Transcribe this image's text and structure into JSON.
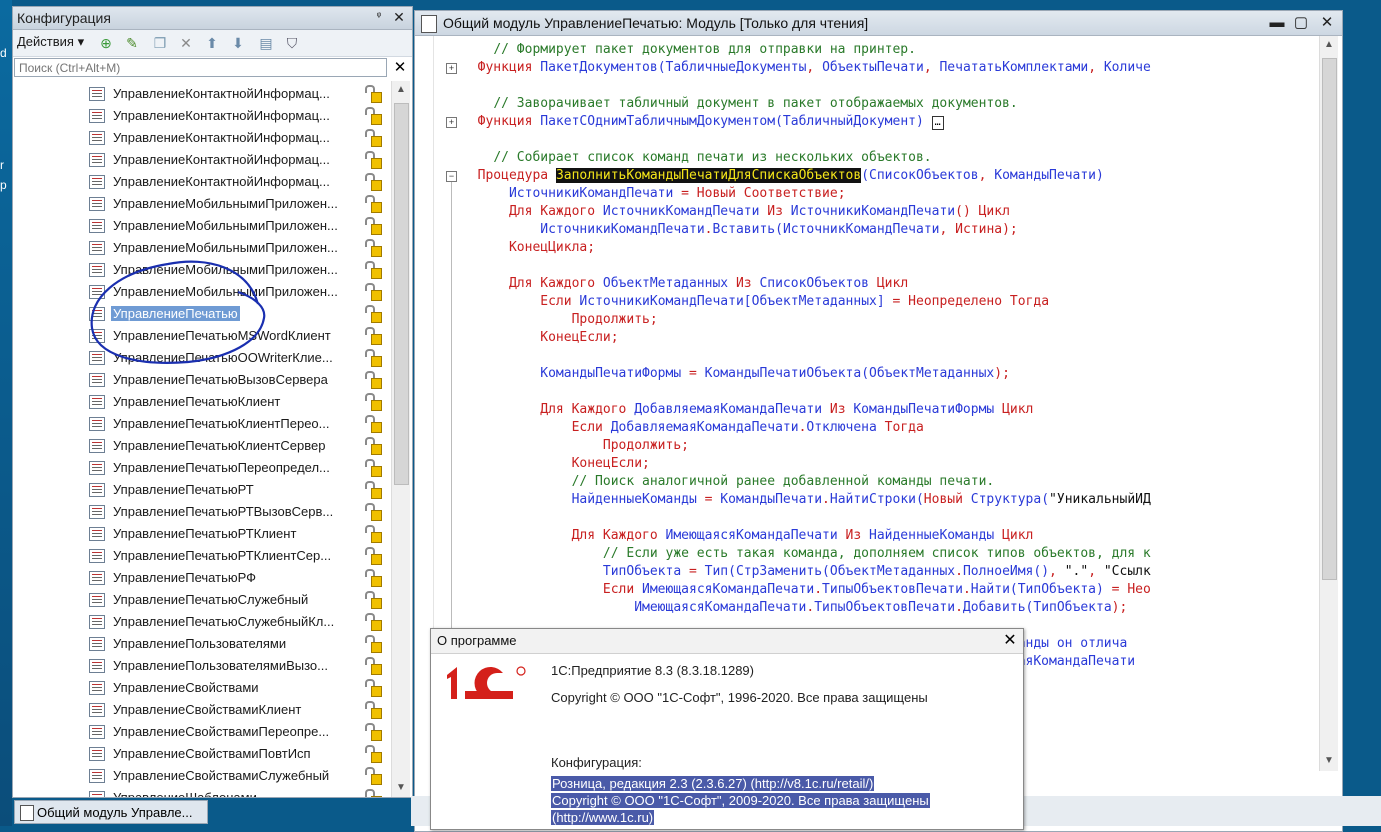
{
  "desktop": {
    "glyphs": [
      "d",
      "r",
      "p"
    ]
  },
  "config_panel": {
    "title": "Конфигурация",
    "pin_label": "ᵠ",
    "close_label": "✕",
    "actions_label": "Действия ▾",
    "search_placeholder": "Поиск (Ctrl+Alt+M)",
    "search_clear": "✕",
    "tree_items": [
      "УправлениеКонтактнойИнформац...",
      "УправлениеКонтактнойИнформац...",
      "УправлениеКонтактнойИнформац...",
      "УправлениеКонтактнойИнформац...",
      "УправлениеКонтактнойИнформац...",
      "УправлениеМобильнымиПриложен...",
      "УправлениеМобильнымиПриложен...",
      "УправлениеМобильнымиПриложен...",
      "УправлениеМобильнымиПриложен...",
      "УправлениеМобильнымиПриложен...",
      "УправлениеПечатью",
      "УправлениеПечатьюMSWordКлиент",
      "УправлениеПечатьюOOWriterКлие...",
      "УправлениеПечатьюВызовСервера",
      "УправлениеПечатьюКлиент",
      "УправлениеПечатьюКлиентПерео...",
      "УправлениеПечатьюКлиентСервер",
      "УправлениеПечатьюПереопредел...",
      "УправлениеПечатьюРТ",
      "УправлениеПечатьюРТВызовСерв...",
      "УправлениеПечатьюРТКлиент",
      "УправлениеПечатьюРТКлиентСер...",
      "УправлениеПечатьюРФ",
      "УправлениеПечатьюСлужебный",
      "УправлениеПечатьюСлужебныйКл...",
      "УправлениеПользователями",
      "УправлениеПользователямиВызо...",
      "УправлениеСвойствами",
      "УправлениеСвойствамиКлиент",
      "УправлениеСвойствамиПереопре...",
      "УправлениеСвойствамиПовтИсп",
      "УправлениеСвойствамиСлужебный",
      "УправлениеШаблонами"
    ],
    "selected_index": 10
  },
  "module_window": {
    "title": "Общий модуль УправлениеПечатью: Модуль [Только для чтения]",
    "minimize_label": "▬",
    "maximize_label": "▢",
    "close_label": "✕"
  },
  "about_dialog": {
    "title": "О программе",
    "close_label": "✕",
    "product": "1С:Предприятие 8.3 (8.3.18.1289)",
    "copyright": "Copyright © ООО \"1С-Софт\", 1996-2020. Все права защищены",
    "config_label": "Конфигурация:",
    "config_line1": "Розница, редакция 2.3 (2.3.6.27) (http://v8.1c.ru/retail/)",
    "config_line2": "Copyright © ООО \"1С-Софт\", 2009-2020. Все права защищены",
    "config_line3": "(http://www.1c.ru)"
  },
  "taskbar": {
    "tab_label": "Общий модуль Управле..."
  },
  "colors": {
    "keyword": "#c82020",
    "identifier": "#2a3ad8",
    "comment": "#2a7a2a",
    "highlight_bg": "#111111",
    "highlight_fg": "#f5e61a",
    "selection": "#6f9bd4"
  },
  "icons": [
    "search-icon",
    "lock-icon",
    "module-icon",
    "filter-icon",
    "add-icon",
    "edit-icon",
    "delete-icon",
    "up-arrow-icon",
    "down-arrow-icon"
  ]
}
